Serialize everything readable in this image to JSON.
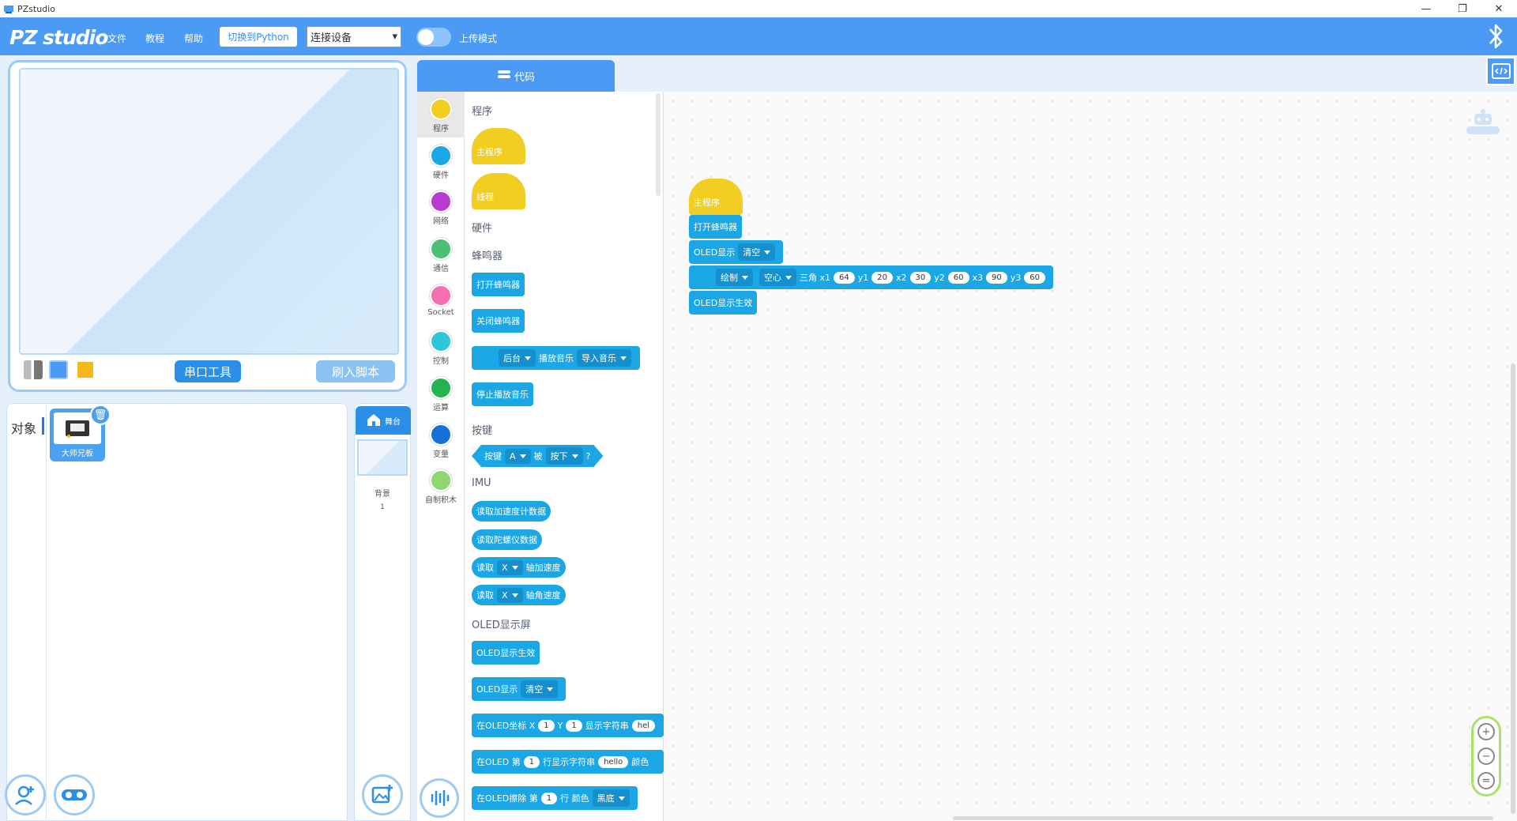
{
  "window": {
    "title": "PZstudio",
    "minimize": "—",
    "restore": "❐",
    "close": "✕"
  },
  "menubar": {
    "logo": "PZ studio",
    "menus": [
      "文件",
      "教程",
      "帮助"
    ],
    "python_button": "切换到Python",
    "connect_select": "连接设备",
    "upload_mode_label": "上传模式",
    "upload_mode_on": false
  },
  "stage": {
    "serial_button": "串口工具",
    "flash_button": "刷入脚本"
  },
  "sprites": {
    "label": "对象",
    "items": [
      {
        "name": "大师兄板"
      }
    ]
  },
  "backdrop": {
    "stage_button": "舞台",
    "label": "背景",
    "count": "1"
  },
  "code_tab": {
    "label": "代码"
  },
  "categories": [
    {
      "label": "程序",
      "color": "#f2cd22",
      "icon": "program-icon"
    },
    {
      "label": "硬件",
      "color": "#1ba6e5",
      "icon": "hardware-icon"
    },
    {
      "label": "网络",
      "color": "#b93cd0",
      "icon": "network-icon"
    },
    {
      "label": "通信",
      "color": "#4bbf73",
      "icon": "communication-icon"
    },
    {
      "label": "Socket",
      "color": "#f56fb0",
      "icon": "socket-icon"
    },
    {
      "label": "控制",
      "color": "#2ec7d8",
      "icon": "control-icon"
    },
    {
      "label": "运算",
      "color": "#25b351",
      "icon": "operator-icon"
    },
    {
      "label": "变量",
      "color": "#1570d8",
      "icon": "variable-icon"
    },
    {
      "label": "自制积木",
      "color": "#8ed86f",
      "icon": "custom-block-icon"
    }
  ],
  "palette": {
    "sections": {
      "program": "程序",
      "hardware": "硬件",
      "buzzer": "蜂鸣器",
      "button": "按键",
      "imu": "IMU",
      "oled": "OLED显示屏"
    },
    "blocks": {
      "main": "主程序",
      "thread": "线程",
      "buzzer_on": "打开蜂鸣器",
      "buzzer_off": "关闭蜂鸣器",
      "bg_mode": "后台",
      "play_music": "播放音乐",
      "import_music": "导入音乐",
      "stop_music": "停止播放音乐",
      "key": "按键",
      "key_a": "A",
      "key_is": "被",
      "key_pressed": "按下",
      "key_q": "?",
      "read_acc": "读取加速度计数据",
      "read_gyro": "读取陀螺仪数据",
      "read": "读取",
      "axis_x": "X",
      "axis_acc": "轴加速度",
      "axis_ang": "轴角速度",
      "oled_apply": "OLED显示生效",
      "oled_show": "OLED显示",
      "clear": "清空",
      "oled_coord": "在OLED坐标 X",
      "y": "Y",
      "one": "1",
      "show_str": "显示字符串",
      "hello_trunc": "hel",
      "oled_row": "在OLED 第",
      "row_show_str": "行显示字符串",
      "hello": "hello",
      "color": "颜色",
      "oled_clear_row": "在OLED擦除 第",
      "row_color": "行 颜色",
      "black": "黑底"
    }
  },
  "workspace": {
    "main": "主程序",
    "buzzer_on": "打开蜂鸣器",
    "oled_show": "OLED显示",
    "clear": "清空",
    "draw": "绘制",
    "hollow": "空心",
    "triangle": "三角 x1",
    "x1": "64",
    "y1_l": "y1",
    "y1": "20",
    "x2_l": "x2",
    "x2": "30",
    "y2_l": "y2",
    "y2": "60",
    "x3_l": "x3",
    "x3": "90",
    "y3_l": "y3",
    "y3": "60",
    "oled_apply": "OLED显示生效"
  },
  "zoom": {
    "zoom_in": "+",
    "zoom_out": "−",
    "reset": "="
  },
  "colors": {
    "accent": "#4b9bf5",
    "hat": "#f2cd22",
    "hardware": "#1ba6e5"
  }
}
